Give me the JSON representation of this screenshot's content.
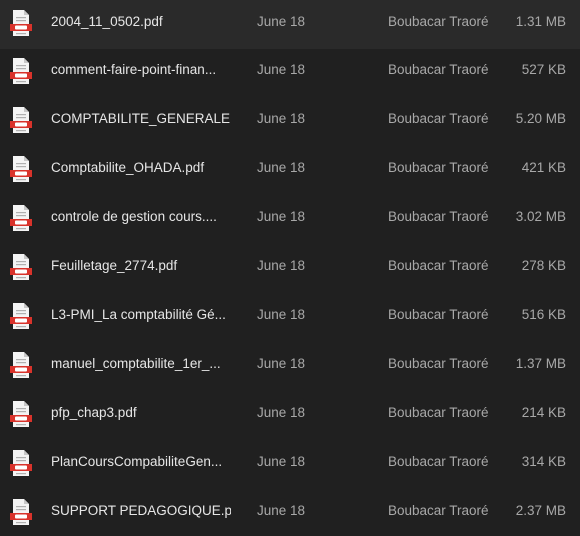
{
  "files": [
    {
      "name": "2004_11_0502.pdf",
      "date": "June 18",
      "owner": "Boubacar Traoré",
      "size": "1.31 MB",
      "icon": "pdf-file-icon"
    },
    {
      "name": "comment-faire-point-finan...",
      "date": "June 18",
      "owner": "Boubacar Traoré",
      "size": "527 KB",
      "icon": "pdf-file-icon"
    },
    {
      "name": "COMPTABILITE_GENERALE....",
      "date": "June 18",
      "owner": "Boubacar Traoré",
      "size": "5.20 MB",
      "icon": "pdf-file-icon"
    },
    {
      "name": "Comptabilite_OHADA.pdf",
      "date": "June 18",
      "owner": "Boubacar Traoré",
      "size": "421 KB",
      "icon": "pdf-file-icon"
    },
    {
      "name": "controle de gestion cours....",
      "date": "June 18",
      "owner": "Boubacar Traoré",
      "size": "3.02 MB",
      "icon": "pdf-file-icon"
    },
    {
      "name": "Feuilletage_2774.pdf",
      "date": "June 18",
      "owner": "Boubacar Traoré",
      "size": "278 KB",
      "icon": "pdf-file-icon"
    },
    {
      "name": "L3-PMI_La comptabilité Gé...",
      "date": "June 18",
      "owner": "Boubacar Traoré",
      "size": "516 KB",
      "icon": "pdf-file-icon"
    },
    {
      "name": "manuel_comptabilite_1er_...",
      "date": "June 18",
      "owner": "Boubacar Traoré",
      "size": "1.37 MB",
      "icon": "pdf-file-icon"
    },
    {
      "name": "pfp_chap3.pdf",
      "date": "June 18",
      "owner": "Boubacar Traoré",
      "size": "214 KB",
      "icon": "pdf-file-icon"
    },
    {
      "name": "PlanCoursCompabiliteGen...",
      "date": "June 18",
      "owner": "Boubacar Traoré",
      "size": "314 KB",
      "icon": "pdf-file-icon"
    },
    {
      "name": "SUPPORT PEDAGOGIQUE.p...",
      "date": "June 18",
      "owner": "Boubacar Traoré",
      "size": "2.37 MB",
      "icon": "pdf-file-icon"
    }
  ],
  "colors": {
    "background": "#202020",
    "pdf_red": "#d9332b",
    "pdf_page": "#f4f4f4"
  }
}
